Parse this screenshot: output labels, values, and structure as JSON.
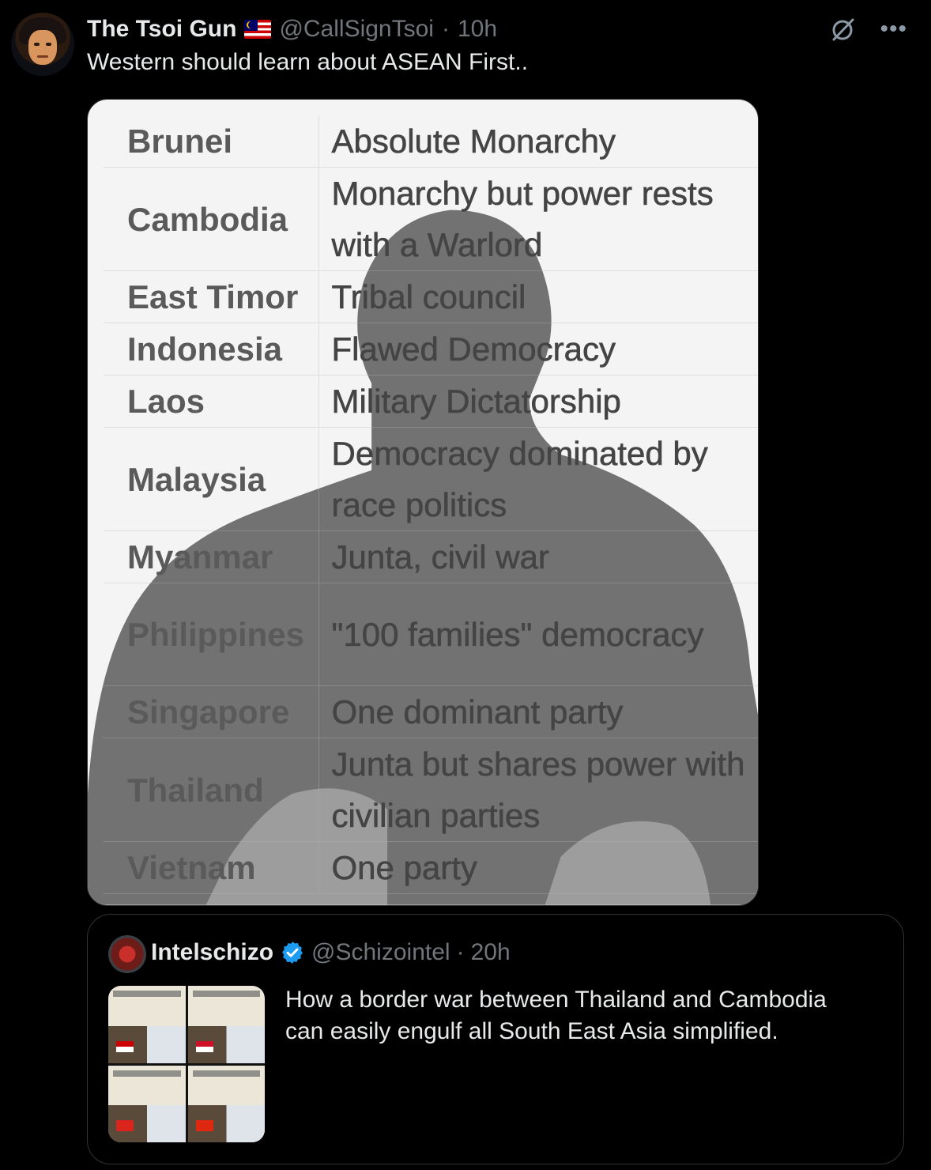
{
  "tweet": {
    "author_name": "The Tsoi Gun",
    "author_handle": "@CallSignTsoi",
    "separator": "·",
    "time": "10h",
    "text": "Western should learn about ASEAN First.."
  },
  "icons": {
    "flag": "malaysia-flag",
    "grok": "grok-slash-icon",
    "more": "more-icon"
  },
  "media_table": {
    "rows": [
      {
        "country": "Brunei",
        "government": "Absolute Monarchy"
      },
      {
        "country": "Cambodia",
        "government": "Monarchy but power rests with a Warlord"
      },
      {
        "country": "East Timor",
        "government": "Tribal council"
      },
      {
        "country": "Indonesia",
        "government": "Flawed Democracy"
      },
      {
        "country": "Laos",
        "government": "Military Dictatorship"
      },
      {
        "country": "Malaysia",
        "government": "Democracy dominated by race politics"
      },
      {
        "country": "Myanmar",
        "government": "Junta, civil war"
      },
      {
        "country": "Philippines",
        "government": "\"100 families\" democracy"
      },
      {
        "country": "Singapore",
        "government": "One dominant party"
      },
      {
        "country": "Thailand",
        "government": "Junta but shares power with civilian parties"
      },
      {
        "country": "Vietnam",
        "government": "One party"
      }
    ]
  },
  "quote": {
    "author_name": "Intelschizo",
    "author_handle": "@Schizointel",
    "separator": "·",
    "time": "20h",
    "text": "How a border war between Thailand and Cambodia can easily engulf all South East Asia simplified."
  },
  "colors": {
    "background": "#000000",
    "text": "#e7e9ea",
    "muted": "#71767b",
    "verified": "#1d9bf0",
    "border": "#2f3336"
  }
}
